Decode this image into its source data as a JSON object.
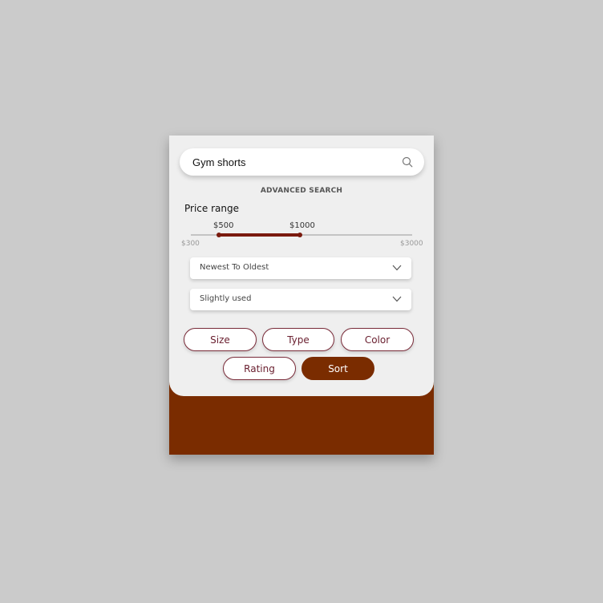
{
  "search": {
    "value": "Gym shorts",
    "icon": "search-icon"
  },
  "advanced_search_label": "ADVANCED SEARCH",
  "price_range": {
    "title": "Price range",
    "selected_min_label": "$500",
    "selected_max_label": "$1000",
    "bound_min_label": "$300",
    "bound_max_label": "$3000"
  },
  "dropdowns": [
    {
      "selected": "Newest To Oldest"
    },
    {
      "selected": "Slightly used"
    }
  ],
  "filters": {
    "size": "Size",
    "type": "Type",
    "color": "Color",
    "rating": "Rating",
    "sort": "Sort"
  },
  "colors": {
    "accent": "#7a2c00",
    "slider_range": "#7a1a0e",
    "background": "#cbcbcb",
    "panel": "#efefef"
  }
}
